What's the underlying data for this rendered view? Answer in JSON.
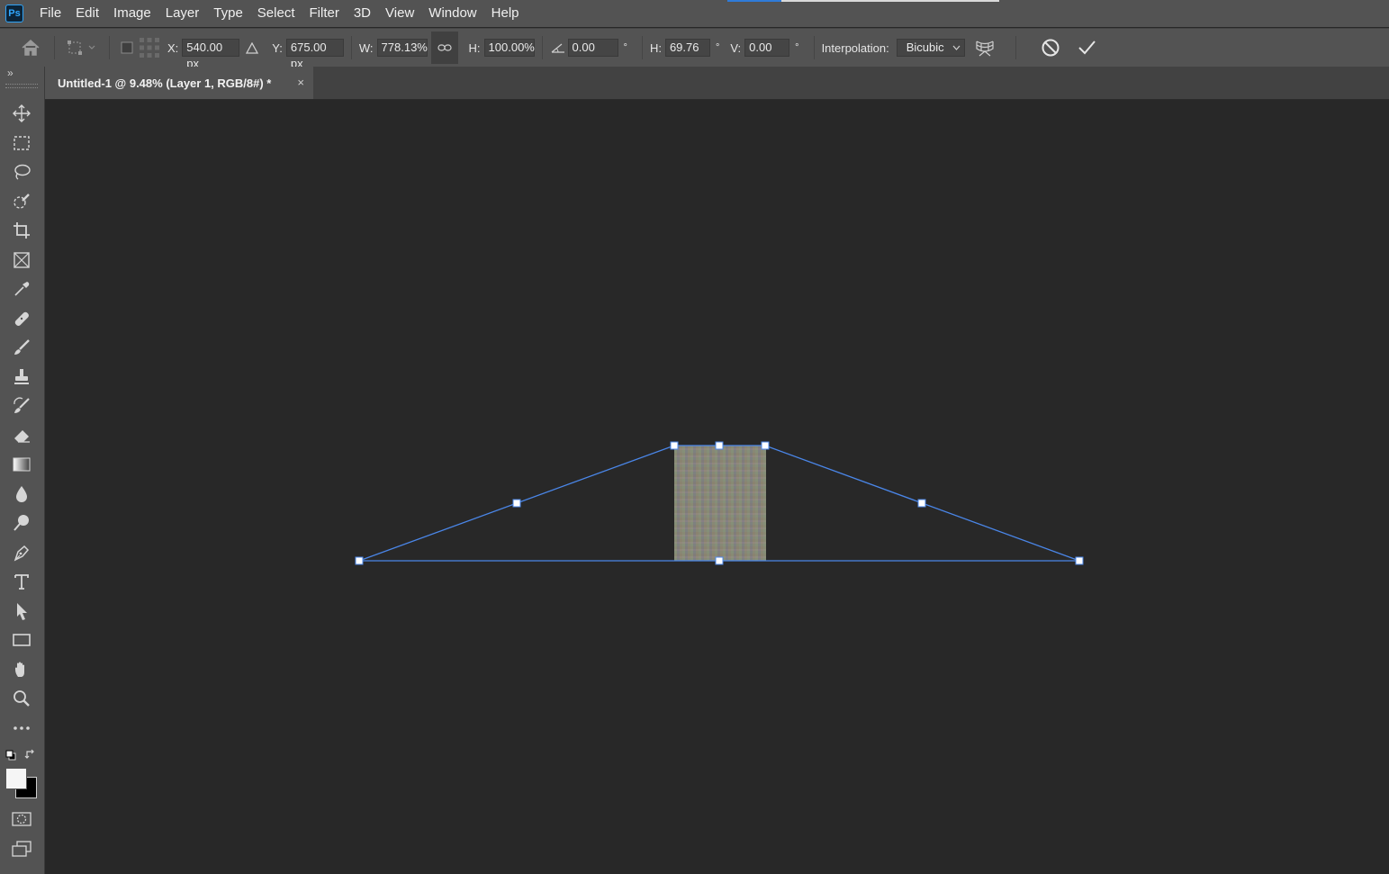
{
  "app": {
    "logo_text": "Ps"
  },
  "menu": [
    "File",
    "Edit",
    "Image",
    "Layer",
    "Type",
    "Select",
    "Filter",
    "3D",
    "View",
    "Window",
    "Help"
  ],
  "options": {
    "x_label": "X:",
    "x_value": "540.00 px",
    "y_label": "Y:",
    "y_value": "675.00 px",
    "w_label": "W:",
    "w_value": "778.13%",
    "h_label": "H:",
    "h_value": "100.00%",
    "angle_value": "0.00",
    "hskew_label": "H:",
    "hskew_value": "69.76",
    "vskew_label": "V:",
    "vskew_value": "0.00",
    "degree_symbol": "°",
    "interpolation_label": "Interpolation:",
    "interpolation_value": "Bicubic"
  },
  "document": {
    "tab_title": "Untitled-1 @ 9.48% (Layer 1, RGB/8#) *",
    "close_symbol": "×"
  },
  "tools": [
    "move-tool",
    "rectangular-marquee-tool",
    "lasso-tool",
    "object-selection-tool",
    "crop-tool",
    "frame-tool",
    "eyedropper-tool",
    "healing-brush-tool",
    "brush-tool",
    "clone-stamp-tool",
    "history-brush-tool",
    "eraser-tool",
    "gradient-tool",
    "blur-tool",
    "dodge-tool",
    "pen-tool",
    "type-tool",
    "path-selection-tool",
    "rectangle-tool",
    "hand-tool",
    "zoom-tool",
    "more-tools"
  ],
  "colors": {
    "foreground": "#f5f5f5",
    "background": "#000000",
    "transform_line": "#4a86e8",
    "canvas_bg": "#282828",
    "panel_bg": "#535353"
  }
}
